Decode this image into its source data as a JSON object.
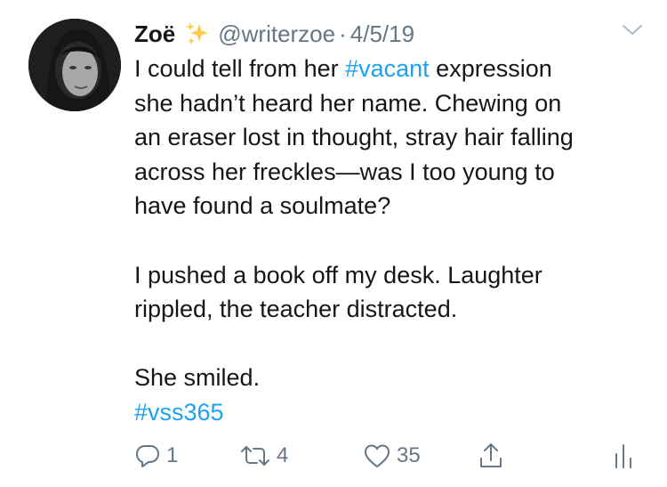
{
  "tweet": {
    "display_name": "Zoë",
    "handle": "@writerzoe",
    "separator": "·",
    "date": "4/5/19",
    "lines": [
      {
        "before": "I could tell from her ",
        "hashtag": "#vacant",
        "after": " expression"
      },
      {
        "text": "she hadn’t heard her name. Chewing on"
      },
      {
        "text": "an eraser lost in thought, stray hair falling"
      },
      {
        "text": "across her freckles—was I too young to"
      },
      {
        "text": "have found a soulmate?"
      },
      {
        "text": "I pushed a book off my desk. Laughter"
      },
      {
        "text": "rippled, the teacher distracted."
      },
      {
        "text": "She smiled."
      },
      {
        "hashtag": "#vss365"
      }
    ]
  },
  "actions": {
    "reply_count": "1",
    "retweet_count": "4",
    "like_count": "35"
  },
  "icons": {
    "sparkles": "sparkles-icon",
    "chevron": "chevron-down-icon",
    "reply": "reply-icon",
    "retweet": "retweet-icon",
    "like": "heart-icon",
    "share": "share-icon",
    "analytics": "analytics-icon"
  },
  "colors": {
    "text": "#14171a",
    "secondary": "#657786",
    "link": "#1da1f2",
    "sparkle": "#ffcc4d"
  }
}
